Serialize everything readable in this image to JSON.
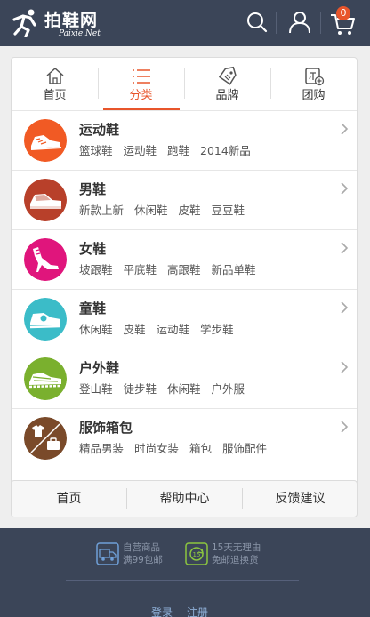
{
  "header": {
    "logo_title": "拍鞋网",
    "logo_sub": "Paixie.Net",
    "cart_count": "0"
  },
  "tabs": [
    {
      "label": "首页",
      "icon": "home-icon",
      "active": false
    },
    {
      "label": "分类",
      "icon": "list-icon",
      "active": true
    },
    {
      "label": "品牌",
      "icon": "tag-icon",
      "active": false
    },
    {
      "label": "团购",
      "icon": "group-buy-icon",
      "active": false
    }
  ],
  "categories": [
    {
      "title": "运动鞋",
      "tags": [
        "篮球鞋",
        "运动鞋",
        "跑鞋",
        "2014新品"
      ],
      "color": "#f15a24"
    },
    {
      "title": "男鞋",
      "tags": [
        "新款上新",
        "休闲鞋",
        "皮鞋",
        "豆豆鞋"
      ],
      "color": "#b8402a"
    },
    {
      "title": "女鞋",
      "tags": [
        "坡跟鞋",
        "平底鞋",
        "高跟鞋",
        "新品单鞋"
      ],
      "color": "#e0157c"
    },
    {
      "title": "童鞋",
      "tags": [
        "休闲鞋",
        "皮鞋",
        "运动鞋",
        "学步鞋"
      ],
      "color": "#3bbcc8"
    },
    {
      "title": "户外鞋",
      "tags": [
        "登山鞋",
        "徒步鞋",
        "休闲鞋",
        "户外服"
      ],
      "color": "#7ab02e"
    },
    {
      "title": "服饰箱包",
      "tags": [
        "精品男装",
        "时尚女装",
        "箱包",
        "服饰配件"
      ],
      "color": "#7a4a2a"
    }
  ],
  "bottom_nav": [
    "首页",
    "帮助中心",
    "反馈建议"
  ],
  "footer": {
    "promo1_line1": "自营商品",
    "promo1_line2": "满99包邮",
    "promo2_line1": "15天无理由",
    "promo2_line2": "免邮退换货",
    "login": "登录",
    "register": "注册"
  },
  "colors": {
    "header_bg": "#3b4558",
    "accent": "#e8552b"
  }
}
